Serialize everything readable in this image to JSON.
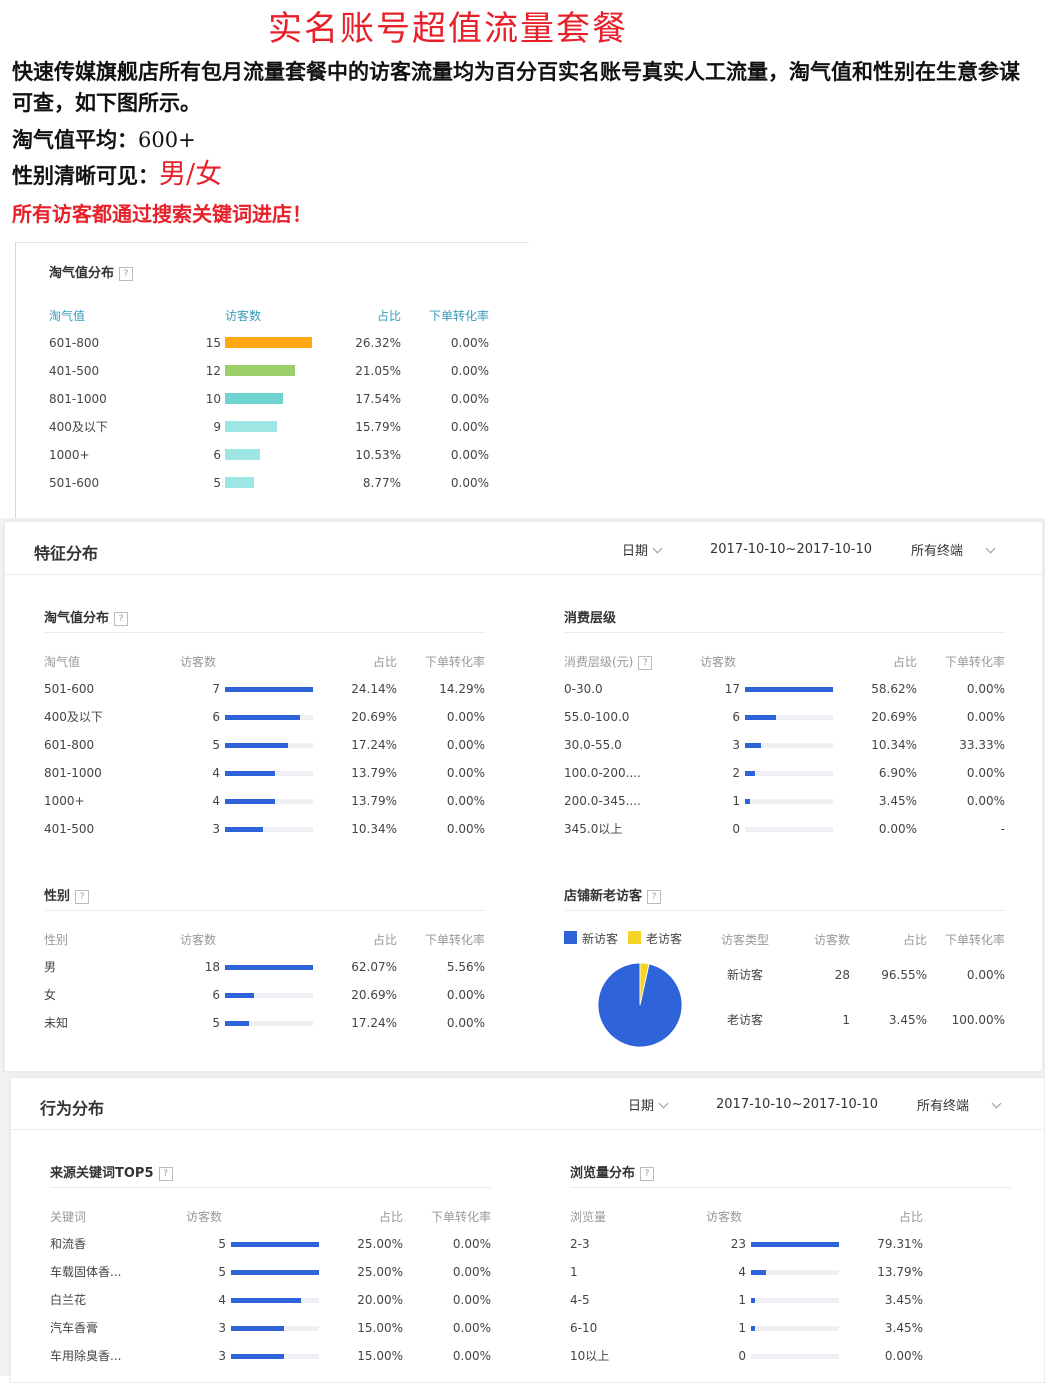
{
  "promo": {
    "title": "实名账号超值流量套餐",
    "intro": "快速传媒旗舰店所有包月流量套餐中的访客流量均为百分百实名账号真实人工流量，淘气值和性别在生意参谋可查，如下图所示。",
    "avg_label": "淘气值平均：",
    "avg_value": "600+",
    "gender_label": "性别清晰可见：",
    "gender_value": "男/女",
    "search_note": "所有访客都通过搜索关键词进店！"
  },
  "colors": {
    "red": "#e8202a",
    "blue": "#2e63d9",
    "yellow": "#f5d327",
    "orange": "#ffa813",
    "green": "#9bd06a",
    "teal": "#6fd3cf",
    "cyan": "#9ee6e4"
  },
  "taoqi_panel": {
    "title": "淘气值分布",
    "help": "?",
    "headers": [
      "淘气值",
      "访客数",
      "占比",
      "下单转化率"
    ],
    "max": 15,
    "rows": [
      {
        "label": "601-800",
        "visitors": "15",
        "value": 15,
        "share": "26.32%",
        "conv": "0.00%",
        "color": "#ffa813"
      },
      {
        "label": "401-500",
        "visitors": "12",
        "value": 12,
        "share": "21.05%",
        "conv": "0.00%",
        "color": "#9bd06a"
      },
      {
        "label": "801-1000",
        "visitors": "10",
        "value": 10,
        "share": "17.54%",
        "conv": "0.00%",
        "color": "#6fd3cf"
      },
      {
        "label": "400及以下",
        "visitors": "9",
        "value": 9,
        "share": "15.79%",
        "conv": "0.00%",
        "color": "#9ee6e4"
      },
      {
        "label": "1000+",
        "visitors": "6",
        "value": 6,
        "share": "10.53%",
        "conv": "0.00%",
        "color": "#9ee6e4"
      },
      {
        "label": "501-600",
        "visitors": "5",
        "value": 5,
        "share": "8.77%",
        "conv": "0.00%",
        "color": "#9ee6e4"
      }
    ]
  },
  "feature": {
    "title": "特征分布",
    "date_label": "日期",
    "date_range": "2017-10-10~2017-10-10",
    "terminal": "所有终端",
    "taoqi": {
      "title": "淘气值分布",
      "headers": [
        "淘气值",
        "访客数",
        "占比",
        "下单转化率"
      ],
      "max": 7,
      "rows": [
        {
          "label": "501-600",
          "visitors": "7",
          "value": 7,
          "share": "24.14%",
          "conv": "14.29%"
        },
        {
          "label": "400及以下",
          "visitors": "6",
          "value": 6,
          "share": "20.69%",
          "conv": "0.00%"
        },
        {
          "label": "601-800",
          "visitors": "5",
          "value": 5,
          "share": "17.24%",
          "conv": "0.00%"
        },
        {
          "label": "801-1000",
          "visitors": "4",
          "value": 4,
          "share": "13.79%",
          "conv": "0.00%"
        },
        {
          "label": "1000+",
          "visitors": "4",
          "value": 4,
          "share": "13.79%",
          "conv": "0.00%"
        },
        {
          "label": "401-500",
          "visitors": "3",
          "value": 3,
          "share": "10.34%",
          "conv": "0.00%"
        }
      ]
    },
    "spending": {
      "title": "消费层级",
      "headers": [
        "消费层级(元)",
        "访客数",
        "占比",
        "下单转化率"
      ],
      "max": 17,
      "rows": [
        {
          "label": "0-30.0",
          "visitors": "17",
          "value": 17,
          "share": "58.62%",
          "conv": "0.00%"
        },
        {
          "label": "55.0-100.0",
          "visitors": "6",
          "value": 6,
          "share": "20.69%",
          "conv": "0.00%"
        },
        {
          "label": "30.0-55.0",
          "visitors": "3",
          "value": 3,
          "share": "10.34%",
          "conv": "33.33%"
        },
        {
          "label": "100.0-200....",
          "visitors": "2",
          "value": 2,
          "share": "6.90%",
          "conv": "0.00%"
        },
        {
          "label": "200.0-345....",
          "visitors": "1",
          "value": 1,
          "share": "3.45%",
          "conv": "0.00%"
        },
        {
          "label": "345.0以上",
          "visitors": "0",
          "value": 0,
          "share": "0.00%",
          "conv": "-"
        }
      ]
    },
    "gender": {
      "title": "性别",
      "headers": [
        "性别",
        "访客数",
        "占比",
        "下单转化率"
      ],
      "max": 18,
      "rows": [
        {
          "label": "男",
          "visitors": "18",
          "value": 18,
          "share": "62.07%",
          "conv": "5.56%"
        },
        {
          "label": "女",
          "visitors": "6",
          "value": 6,
          "share": "20.69%",
          "conv": "0.00%"
        },
        {
          "label": "未知",
          "visitors": "5",
          "value": 5,
          "share": "17.24%",
          "conv": "0.00%"
        }
      ]
    },
    "visitors": {
      "title": "店铺新老访客",
      "legend": [
        "新访客",
        "老访客"
      ],
      "headers": [
        "访客类型",
        "访客数",
        "占比",
        "下单转化率"
      ],
      "rows": [
        {
          "label": "新访客",
          "visitors": "28",
          "value": 28,
          "share": "96.55%",
          "conv": "0.00%"
        },
        {
          "label": "老访客",
          "visitors": "1",
          "value": 1,
          "share": "3.45%",
          "conv": "100.00%"
        }
      ]
    }
  },
  "behavior": {
    "title": "行为分布",
    "date_label": "日期",
    "date_range": "2017-10-10~2017-10-10",
    "terminal": "所有终端",
    "keywords": {
      "title": "来源关键词TOP5",
      "headers": [
        "关键词",
        "访客数",
        "占比",
        "下单转化率"
      ],
      "max": 5,
      "rows": [
        {
          "label": "和流香",
          "visitors": "5",
          "value": 5,
          "share": "25.00%",
          "conv": "0.00%"
        },
        {
          "label": "车载固体香...",
          "visitors": "5",
          "value": 5,
          "share": "25.00%",
          "conv": "0.00%"
        },
        {
          "label": "白兰花",
          "visitors": "4",
          "value": 4,
          "share": "20.00%",
          "conv": "0.00%"
        },
        {
          "label": "汽车香膏",
          "visitors": "3",
          "value": 3,
          "share": "15.00%",
          "conv": "0.00%"
        },
        {
          "label": "车用除臭香...",
          "visitors": "3",
          "value": 3,
          "share": "15.00%",
          "conv": "0.00%"
        }
      ]
    },
    "pageviews": {
      "title": "浏览量分布",
      "headers": [
        "浏览量",
        "访客数",
        "占比"
      ],
      "max": 23,
      "rows": [
        {
          "label": "2-3",
          "visitors": "23",
          "value": 23,
          "share": "79.31%"
        },
        {
          "label": "1",
          "visitors": "4",
          "value": 4,
          "share": "13.79%"
        },
        {
          "label": "4-5",
          "visitors": "1",
          "value": 1,
          "share": "3.45%"
        },
        {
          "label": "6-10",
          "visitors": "1",
          "value": 1,
          "share": "3.45%"
        },
        {
          "label": "10以上",
          "visitors": "0",
          "value": 0,
          "share": "0.00%"
        }
      ]
    }
  }
}
